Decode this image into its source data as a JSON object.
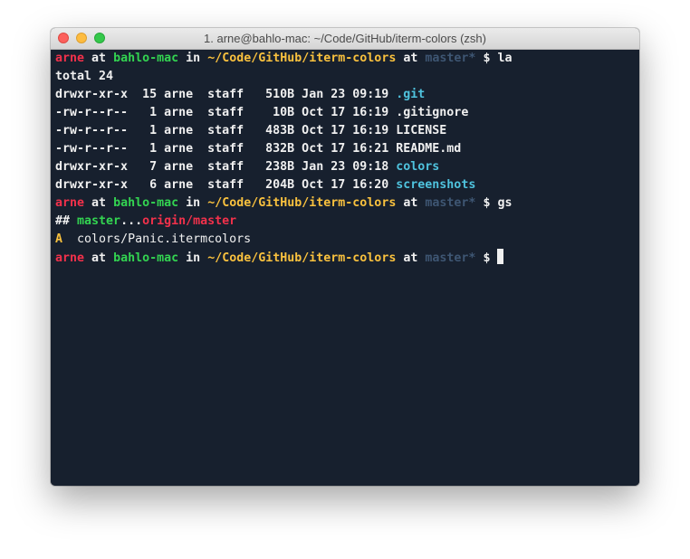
{
  "window": {
    "title": "1. arne@bahlo-mac: ~/Code/GitHub/iterm-colors (zsh)"
  },
  "colors": {
    "background": "#17202e",
    "user": "#f2314b",
    "host": "#33d451",
    "path": "#f9c13e",
    "branch": "#3e5673",
    "directory": "#4fc3de",
    "text": "#f0f0f0"
  },
  "prompt": {
    "user": "arne",
    "at1": "at",
    "host": "bahlo-mac",
    "in": "in",
    "path": "~/Code/GitHub/iterm-colors",
    "at2": "at",
    "branch": "master*",
    "symbol": "$"
  },
  "commands": {
    "first": "la",
    "second": "gs"
  },
  "listing": {
    "total": "total 24",
    "rows": [
      {
        "perms": "drwxr-xr-x",
        "links": "15",
        "owner": "arne",
        "group": "staff",
        "size": "510B",
        "date": "Jan 23 09:19",
        "name": ".git",
        "is_dir": true
      },
      {
        "perms": "-rw-r--r--",
        "links": "1",
        "owner": "arne",
        "group": "staff",
        "size": "10B",
        "date": "Oct 17 16:19",
        "name": ".gitignore",
        "is_dir": false
      },
      {
        "perms": "-rw-r--r--",
        "links": "1",
        "owner": "arne",
        "group": "staff",
        "size": "483B",
        "date": "Oct 17 16:19",
        "name": "LICENSE",
        "is_dir": false
      },
      {
        "perms": "-rw-r--r--",
        "links": "1",
        "owner": "arne",
        "group": "staff",
        "size": "832B",
        "date": "Oct 17 16:21",
        "name": "README.md",
        "is_dir": false
      },
      {
        "perms": "drwxr-xr-x",
        "links": "7",
        "owner": "arne",
        "group": "staff",
        "size": "238B",
        "date": "Jan 23 09:18",
        "name": "colors",
        "is_dir": true
      },
      {
        "perms": "drwxr-xr-x",
        "links": "6",
        "owner": "arne",
        "group": "staff",
        "size": "204B",
        "date": "Oct 17 16:20",
        "name": "screenshots",
        "is_dir": true
      }
    ]
  },
  "git_status": {
    "header_prefix": "##",
    "local_branch": "master",
    "separator": "...",
    "remote_branch": "origin/master",
    "change_code": "A",
    "change_path": "colors/Panic.itermcolors"
  }
}
